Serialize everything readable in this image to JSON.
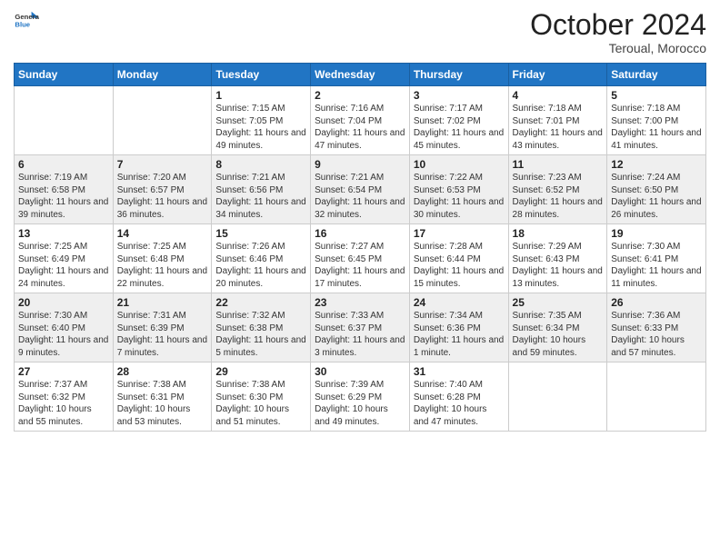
{
  "logo": {
    "line1": "General",
    "line2": "Blue"
  },
  "header": {
    "month": "October 2024",
    "location": "Teroual, Morocco"
  },
  "days_of_week": [
    "Sunday",
    "Monday",
    "Tuesday",
    "Wednesday",
    "Thursday",
    "Friday",
    "Saturday"
  ],
  "weeks": [
    [
      {
        "day": "",
        "info": ""
      },
      {
        "day": "",
        "info": ""
      },
      {
        "day": "1",
        "info": "Sunrise: 7:15 AM\nSunset: 7:05 PM\nDaylight: 11 hours and 49 minutes."
      },
      {
        "day": "2",
        "info": "Sunrise: 7:16 AM\nSunset: 7:04 PM\nDaylight: 11 hours and 47 minutes."
      },
      {
        "day": "3",
        "info": "Sunrise: 7:17 AM\nSunset: 7:02 PM\nDaylight: 11 hours and 45 minutes."
      },
      {
        "day": "4",
        "info": "Sunrise: 7:18 AM\nSunset: 7:01 PM\nDaylight: 11 hours and 43 minutes."
      },
      {
        "day": "5",
        "info": "Sunrise: 7:18 AM\nSunset: 7:00 PM\nDaylight: 11 hours and 41 minutes."
      }
    ],
    [
      {
        "day": "6",
        "info": "Sunrise: 7:19 AM\nSunset: 6:58 PM\nDaylight: 11 hours and 39 minutes."
      },
      {
        "day": "7",
        "info": "Sunrise: 7:20 AM\nSunset: 6:57 PM\nDaylight: 11 hours and 36 minutes."
      },
      {
        "day": "8",
        "info": "Sunrise: 7:21 AM\nSunset: 6:56 PM\nDaylight: 11 hours and 34 minutes."
      },
      {
        "day": "9",
        "info": "Sunrise: 7:21 AM\nSunset: 6:54 PM\nDaylight: 11 hours and 32 minutes."
      },
      {
        "day": "10",
        "info": "Sunrise: 7:22 AM\nSunset: 6:53 PM\nDaylight: 11 hours and 30 minutes."
      },
      {
        "day": "11",
        "info": "Sunrise: 7:23 AM\nSunset: 6:52 PM\nDaylight: 11 hours and 28 minutes."
      },
      {
        "day": "12",
        "info": "Sunrise: 7:24 AM\nSunset: 6:50 PM\nDaylight: 11 hours and 26 minutes."
      }
    ],
    [
      {
        "day": "13",
        "info": "Sunrise: 7:25 AM\nSunset: 6:49 PM\nDaylight: 11 hours and 24 minutes."
      },
      {
        "day": "14",
        "info": "Sunrise: 7:25 AM\nSunset: 6:48 PM\nDaylight: 11 hours and 22 minutes."
      },
      {
        "day": "15",
        "info": "Sunrise: 7:26 AM\nSunset: 6:46 PM\nDaylight: 11 hours and 20 minutes."
      },
      {
        "day": "16",
        "info": "Sunrise: 7:27 AM\nSunset: 6:45 PM\nDaylight: 11 hours and 17 minutes."
      },
      {
        "day": "17",
        "info": "Sunrise: 7:28 AM\nSunset: 6:44 PM\nDaylight: 11 hours and 15 minutes."
      },
      {
        "day": "18",
        "info": "Sunrise: 7:29 AM\nSunset: 6:43 PM\nDaylight: 11 hours and 13 minutes."
      },
      {
        "day": "19",
        "info": "Sunrise: 7:30 AM\nSunset: 6:41 PM\nDaylight: 11 hours and 11 minutes."
      }
    ],
    [
      {
        "day": "20",
        "info": "Sunrise: 7:30 AM\nSunset: 6:40 PM\nDaylight: 11 hours and 9 minutes."
      },
      {
        "day": "21",
        "info": "Sunrise: 7:31 AM\nSunset: 6:39 PM\nDaylight: 11 hours and 7 minutes."
      },
      {
        "day": "22",
        "info": "Sunrise: 7:32 AM\nSunset: 6:38 PM\nDaylight: 11 hours and 5 minutes."
      },
      {
        "day": "23",
        "info": "Sunrise: 7:33 AM\nSunset: 6:37 PM\nDaylight: 11 hours and 3 minutes."
      },
      {
        "day": "24",
        "info": "Sunrise: 7:34 AM\nSunset: 6:36 PM\nDaylight: 11 hours and 1 minute."
      },
      {
        "day": "25",
        "info": "Sunrise: 7:35 AM\nSunset: 6:34 PM\nDaylight: 10 hours and 59 minutes."
      },
      {
        "day": "26",
        "info": "Sunrise: 7:36 AM\nSunset: 6:33 PM\nDaylight: 10 hours and 57 minutes."
      }
    ],
    [
      {
        "day": "27",
        "info": "Sunrise: 7:37 AM\nSunset: 6:32 PM\nDaylight: 10 hours and 55 minutes."
      },
      {
        "day": "28",
        "info": "Sunrise: 7:38 AM\nSunset: 6:31 PM\nDaylight: 10 hours and 53 minutes."
      },
      {
        "day": "29",
        "info": "Sunrise: 7:38 AM\nSunset: 6:30 PM\nDaylight: 10 hours and 51 minutes."
      },
      {
        "day": "30",
        "info": "Sunrise: 7:39 AM\nSunset: 6:29 PM\nDaylight: 10 hours and 49 minutes."
      },
      {
        "day": "31",
        "info": "Sunrise: 7:40 AM\nSunset: 6:28 PM\nDaylight: 10 hours and 47 minutes."
      },
      {
        "day": "",
        "info": ""
      },
      {
        "day": "",
        "info": ""
      }
    ]
  ]
}
